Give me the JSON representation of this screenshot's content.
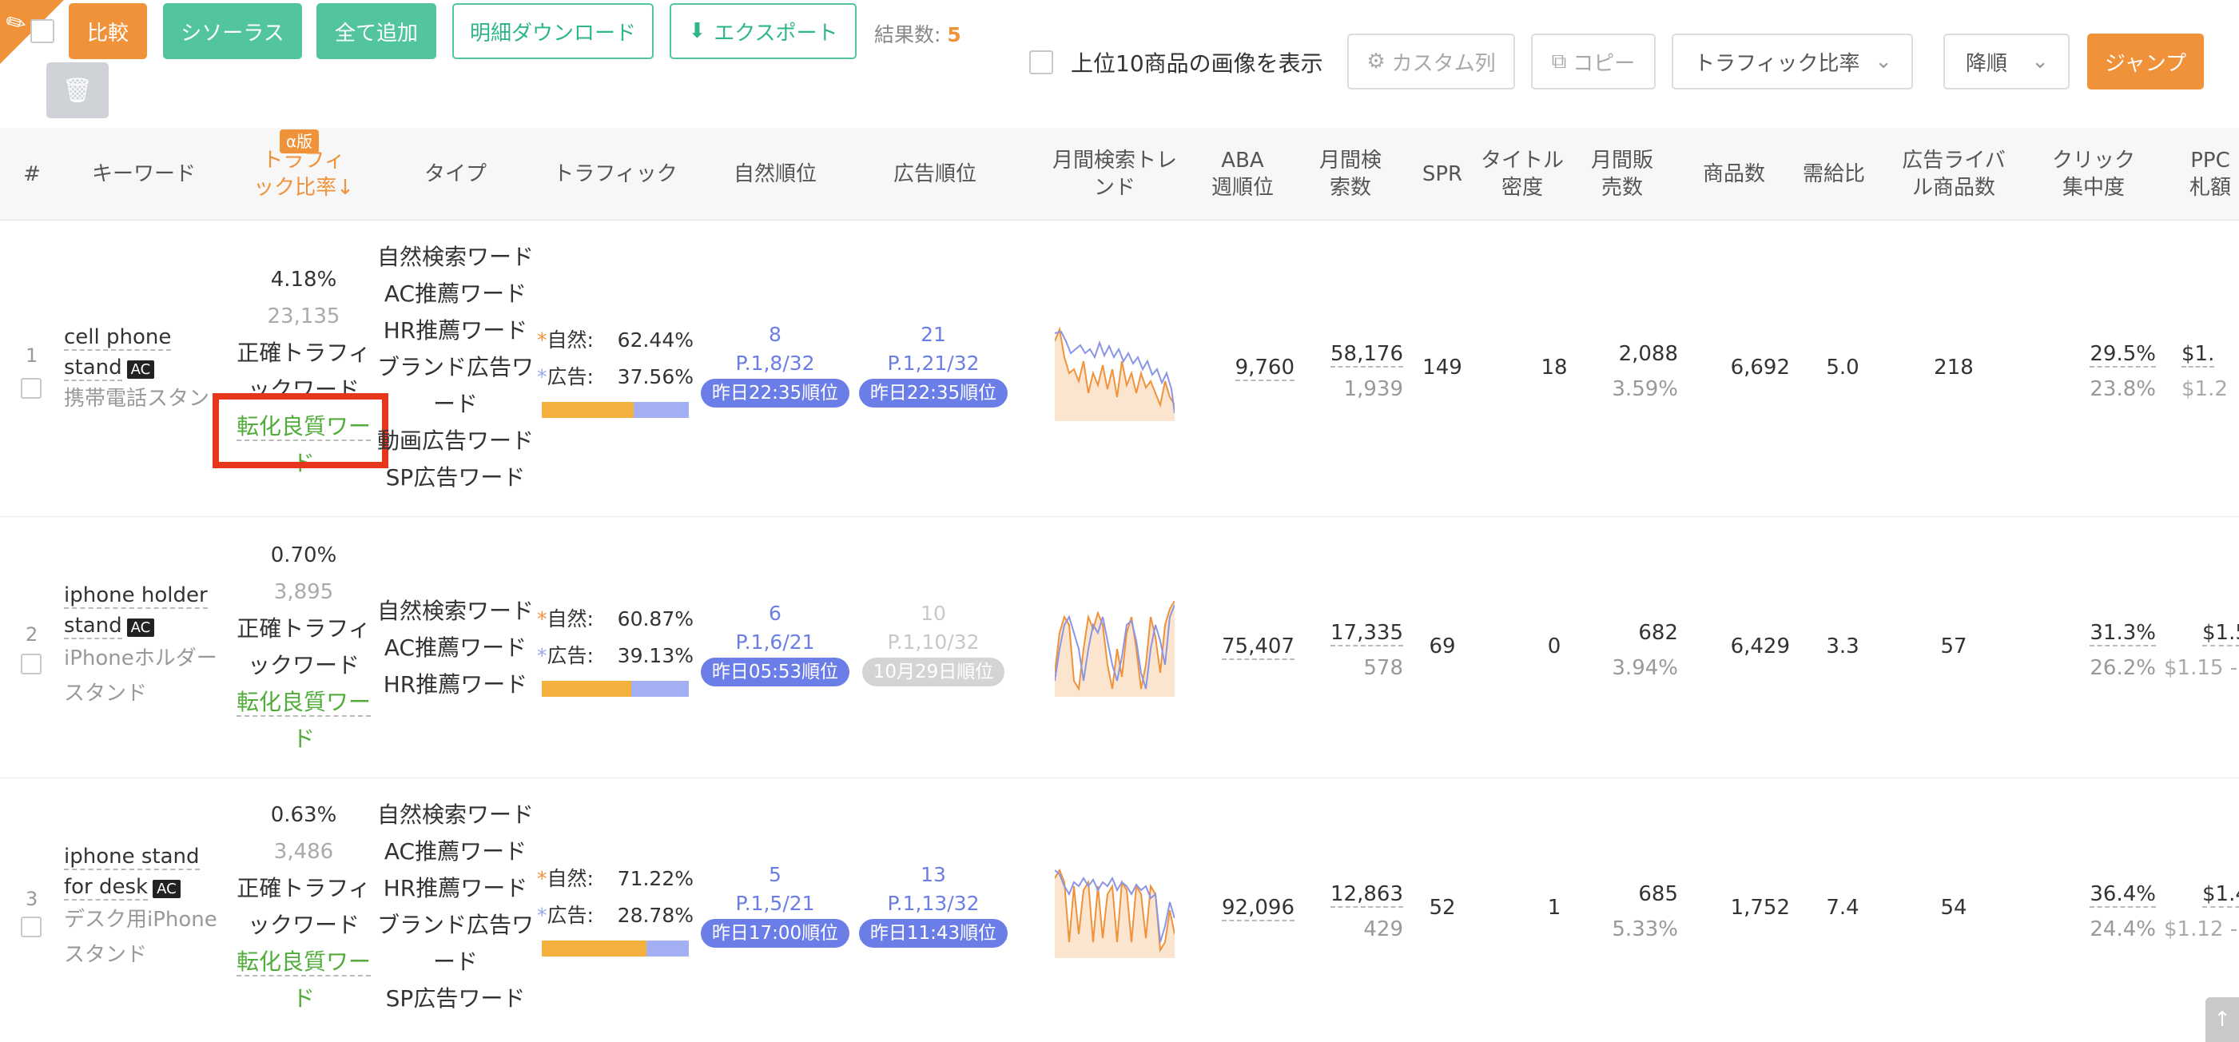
{
  "toolbar": {
    "compare": "比較",
    "thesaurus": "シソーラス",
    "add_all": "全て追加",
    "detail_download": "明細ダウンロード",
    "export": "エクスポート",
    "results_label": "結果数:",
    "results_count": "5",
    "show_top10_images": "上位10商品の画像を表示",
    "custom_columns": "カスタム列",
    "copy": "コピー",
    "sort_field": "トラフィック比率",
    "sort_order": "降順",
    "jump": "ジャンプ"
  },
  "columns": {
    "index": "#",
    "keyword": "キーワード",
    "alpha": "α版",
    "traffic_ratio": "トラフィ\nック比率↓",
    "type": "タイプ",
    "traffic": "トラフィック",
    "organic_rank": "自然順位",
    "ad_rank": "広告順位",
    "monthly_trend": "月間検索トレ\nンド",
    "aba_weekly": "ABA\n週順位",
    "monthly_searches": "月間検\n索数",
    "spr": "SPR",
    "title_density": "タイトル\n密度",
    "monthly_sales": "月間販\n売数",
    "products": "商品数",
    "supply_demand": "需給比",
    "ad_rival_products": "広告ライバ\nル商品数",
    "click_concentration": "クリック\n集中度",
    "ppc_bid": "PPC\n札額"
  },
  "labels": {
    "organic": "自然:",
    "ad": "広告:"
  },
  "rows": [
    {
      "index": "1",
      "keyword_en_1": "cell phone",
      "keyword_en_2": "stand",
      "ac": "AC",
      "keyword_ja": "携帯電話スタン",
      "traffic_ratio": "4.18%",
      "traffic_count": "23,135",
      "tag1_a": "正確トラフィ",
      "tag1_b": "ックワード",
      "tag2_a": "転化良質ワー",
      "tag2_b": "ド",
      "types": [
        "自然検索ワード",
        "AC推薦ワード",
        "HR推薦ワード",
        "ブランド広告ワ",
        "ード",
        "動画広告ワード",
        "SP広告ワード"
      ],
      "organic_pct": "62.44%",
      "ad_pct": "37.56%",
      "organic_share": 0.6244,
      "organic_rank": "8",
      "organic_page": "P.1,8/32",
      "organic_when": "昨日22:35順位",
      "ad_rank": "21",
      "ad_page": "P.1,21/32",
      "ad_when": "昨日22:35順位",
      "aba": "9,760",
      "monthly_searches": "58,176",
      "monthly_searches_sub": "1,939",
      "spr": "149",
      "title_density": "18",
      "monthly_sales": "2,088",
      "monthly_sales_sub": "3.59%",
      "products": "6,692",
      "supply_demand": "5.0",
      "ad_rivals": "218",
      "click_conc": "29.5%",
      "click_conc_sub": "23.8%",
      "ppc": "$1.",
      "ppc_sub": "$1.2"
    },
    {
      "index": "2",
      "keyword_en_1": "iphone holder",
      "keyword_en_2": "stand",
      "ac": "AC",
      "keyword_ja_1": "iPhoneホルダー",
      "keyword_ja_2": "スタンド",
      "traffic_ratio": "0.70%",
      "traffic_count": "3,895",
      "tag1_a": "正確トラフィ",
      "tag1_b": "ックワード",
      "tag2_a": "転化良質ワー",
      "tag2_b": "ド",
      "types": [
        "自然検索ワード",
        "AC推薦ワード",
        "HR推薦ワード"
      ],
      "organic_pct": "60.87%",
      "ad_pct": "39.13%",
      "organic_share": 0.6087,
      "organic_rank": "6",
      "organic_page": "P.1,6/21",
      "organic_when": "昨日05:53順位",
      "ad_rank": "10",
      "ad_page": "P.1,10/32",
      "ad_when": "10月29日順位",
      "aba": "75,407",
      "monthly_searches": "17,335",
      "monthly_searches_sub": "578",
      "spr": "69",
      "title_density": "0",
      "monthly_sales": "682",
      "monthly_sales_sub": "3.94%",
      "products": "6,429",
      "supply_demand": "3.3",
      "ad_rivals": "57",
      "click_conc": "31.3%",
      "click_conc_sub": "26.2%",
      "ppc": "$1.5",
      "ppc_sub": "$1.15 -"
    },
    {
      "index": "3",
      "keyword_en_1": "iphone stand",
      "keyword_en_2": "for desk",
      "ac": "AC",
      "keyword_ja_1": "デスク用iPhone",
      "keyword_ja_2": "スタンド",
      "traffic_ratio": "0.63%",
      "traffic_count": "3,486",
      "tag1_a": "正確トラフィ",
      "tag1_b": "ックワード",
      "tag2_a": "転化良質ワー",
      "tag2_b": "ド",
      "types": [
        "自然検索ワード",
        "AC推薦ワード",
        "HR推薦ワード",
        "ブランド広告ワ",
        "ード",
        "SP広告ワード"
      ],
      "organic_pct": "71.22%",
      "ad_pct": "28.78%",
      "organic_share": 0.7122,
      "organic_rank": "5",
      "organic_page": "P.1,5/21",
      "organic_when": "昨日17:00順位",
      "ad_rank": "13",
      "ad_page": "P.1,13/32",
      "ad_when": "昨日11:43順位",
      "aba": "92,096",
      "monthly_searches": "12,863",
      "monthly_searches_sub": "429",
      "spr": "52",
      "title_density": "1",
      "monthly_sales": "685",
      "monthly_sales_sub": "5.33%",
      "products": "1,752",
      "supply_demand": "7.4",
      "ad_rivals": "54",
      "click_conc": "36.4%",
      "click_conc_sub": "24.4%",
      "ppc": "$1.4",
      "ppc_sub": "$1.12 -"
    }
  ],
  "colors": {
    "orange": "#f0923a",
    "teal": "#52c4a0",
    "blue": "#6b7ee8",
    "green": "#52ac3c",
    "highlight": "#e8361c"
  }
}
